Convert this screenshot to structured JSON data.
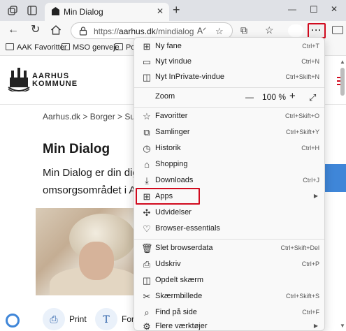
{
  "browser": {
    "tab": {
      "title": "Min Dialog"
    },
    "address": {
      "protocol": "https://",
      "host": "aarhus.dk",
      "path": "/mindialog"
    },
    "favorites": [
      {
        "label": "AAK Favoritter"
      },
      {
        "label": "MSO genveje"
      },
      {
        "label": "Po"
      }
    ]
  },
  "page": {
    "logo_text_line1": "AARHUS",
    "logo_text_line2": "KOMMUNE",
    "breadcrumb": "Aarhus.dk  >  Borger  >  Sund",
    "title": "Min Dialog",
    "intro_line1": "Min Dialog er din dig",
    "intro_line2": "omsorgsområdet i Aa",
    "actions": [
      {
        "label": "Print"
      },
      {
        "label": "Fors"
      }
    ]
  },
  "menu": {
    "items": [
      {
        "label": "Ny fane",
        "shortcut": "Ctrl+T",
        "icon": "new-tab-icon"
      },
      {
        "label": "Nyt vindue",
        "shortcut": "Ctrl+N",
        "icon": "window-icon"
      },
      {
        "label": "Nyt InPrivate-vindue",
        "shortcut": "Ctrl+Skift+N",
        "icon": "inprivate-icon"
      },
      {
        "label": "Favoritter",
        "shortcut": "Ctrl+Skift+O",
        "icon": "favorites-icon"
      },
      {
        "label": "Samlinger",
        "shortcut": "Ctrl+Skift+Y",
        "icon": "collections-icon"
      },
      {
        "label": "Historik",
        "shortcut": "Ctrl+H",
        "icon": "history-icon"
      },
      {
        "label": "Shopping",
        "shortcut": "",
        "icon": "shopping-tag-icon"
      },
      {
        "label": "Downloads",
        "shortcut": "Ctrl+J",
        "icon": "download-icon"
      },
      {
        "label": "Apps",
        "shortcut": "",
        "icon": "apps-grid-icon"
      },
      {
        "label": "Udvidelser",
        "shortcut": "",
        "icon": "extensions-icon"
      },
      {
        "label": "Browser-essentials",
        "shortcut": "",
        "icon": "heart-pulse-icon"
      },
      {
        "label": "Slet browserdata",
        "shortcut": "Ctrl+Skift+Del",
        "icon": "trash-icon"
      },
      {
        "label": "Udskriv",
        "shortcut": "Ctrl+P",
        "icon": "print-icon"
      },
      {
        "label": "Opdelt skærm",
        "shortcut": "",
        "icon": "split-screen-icon"
      },
      {
        "label": "Skærmbillede",
        "shortcut": "Ctrl+Skift+S",
        "icon": "screenshot-icon"
      },
      {
        "label": "Find på side",
        "shortcut": "Ctrl+F",
        "icon": "find-icon"
      },
      {
        "label": "Flere værktøjer",
        "shortcut": "",
        "icon": "more-tools-icon"
      }
    ],
    "zoom": {
      "label": "Zoom",
      "minus": "—",
      "value": "100 %",
      "plus": "+"
    }
  },
  "colors": {
    "highlight": "#d10a1e",
    "accent": "#3f86d8"
  }
}
